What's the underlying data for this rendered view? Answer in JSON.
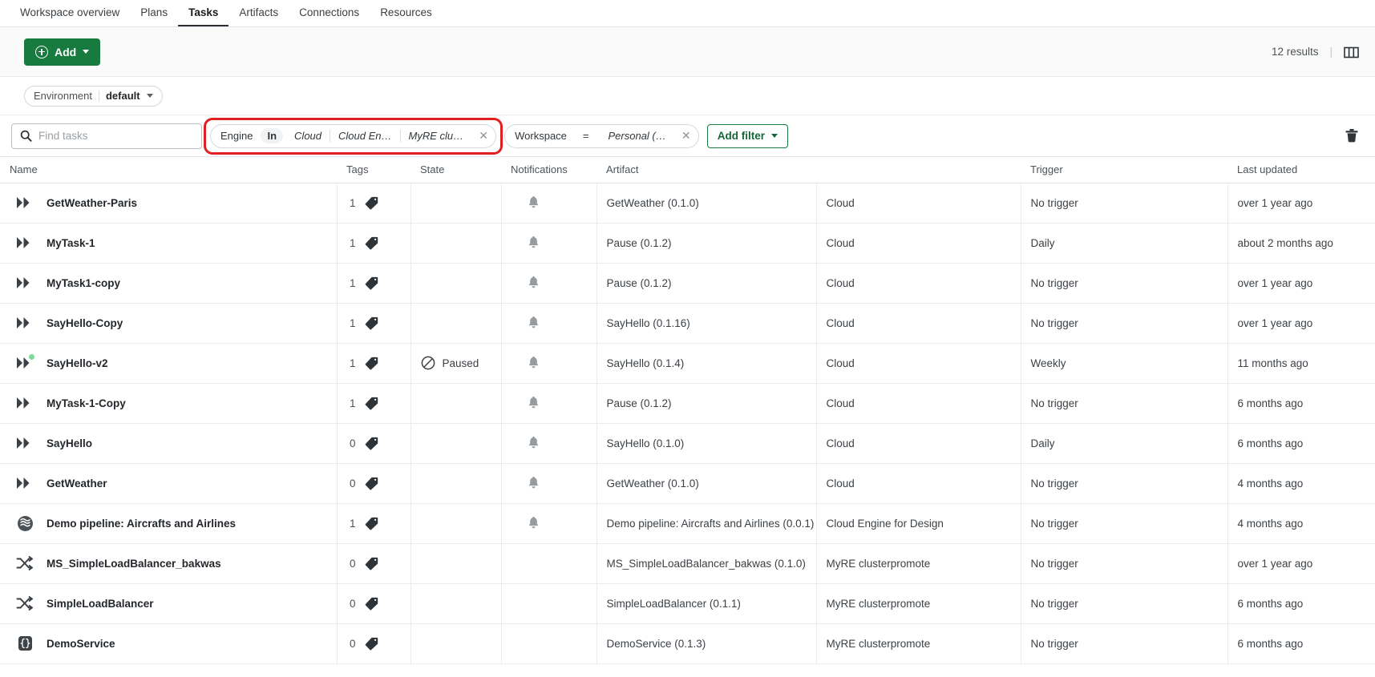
{
  "topnav": {
    "items": [
      {
        "label": "Workspace overview",
        "active": false
      },
      {
        "label": "Plans",
        "active": false
      },
      {
        "label": "Tasks",
        "active": true
      },
      {
        "label": "Artifacts",
        "active": false
      },
      {
        "label": "Connections",
        "active": false
      },
      {
        "label": "Resources",
        "active": false
      }
    ]
  },
  "actionbar": {
    "add_label": "Add",
    "results_count": "12 results",
    "separator": "|",
    "columns_icon": "columns-icon"
  },
  "environment": {
    "label": "Environment",
    "value": "default"
  },
  "search": {
    "placeholder": "Find tasks",
    "value": "",
    "icon": "search-icon"
  },
  "filters": {
    "chips": [
      {
        "field": "Engine",
        "operator": "In",
        "operator_style": "pill",
        "values": [
          "Cloud",
          "Cloud En…",
          "MyRE clu…"
        ],
        "highlighted": true
      },
      {
        "field": "Workspace",
        "operator": "=",
        "operator_style": "plain",
        "values": [
          "Personal (…"
        ],
        "highlighted": false
      }
    ],
    "add_filter_label": "Add filter",
    "clear_icon": "trash-icon",
    "highlight_color": "#e02020"
  },
  "table": {
    "columns": [
      {
        "key": "name",
        "label": "Name"
      },
      {
        "key": "tags",
        "label": "Tags"
      },
      {
        "key": "state",
        "label": "State"
      },
      {
        "key": "notifications",
        "label": "Notifications"
      },
      {
        "key": "artifact",
        "label": "Artifact"
      },
      {
        "key": "engine",
        "label": ""
      },
      {
        "key": "trigger",
        "label": "Trigger"
      },
      {
        "key": "last_updated",
        "label": "Last updated"
      }
    ],
    "rows": [
      {
        "icon": "task-chevrons-icon",
        "status_dot": false,
        "name": "GetWeather-Paris",
        "tags": "1",
        "state": "",
        "notifications": true,
        "artifact": "GetWeather (0.1.0)",
        "engine": "Cloud",
        "trigger": "No trigger",
        "last_updated": "over 1 year ago"
      },
      {
        "icon": "task-chevrons-icon",
        "status_dot": false,
        "name": "MyTask-1",
        "tags": "1",
        "state": "",
        "notifications": true,
        "artifact": "Pause (0.1.2)",
        "engine": "Cloud",
        "trigger": "Daily",
        "last_updated": "about 2 months ago"
      },
      {
        "icon": "task-chevrons-icon",
        "status_dot": false,
        "name": "MyTask1-copy",
        "tags": "1",
        "state": "",
        "notifications": true,
        "artifact": "Pause (0.1.2)",
        "engine": "Cloud",
        "trigger": "No trigger",
        "last_updated": "over 1 year ago"
      },
      {
        "icon": "task-chevrons-icon",
        "status_dot": false,
        "name": "SayHello-Copy",
        "tags": "1",
        "state": "",
        "notifications": true,
        "artifact": "SayHello (0.1.16)",
        "engine": "Cloud",
        "trigger": "No trigger",
        "last_updated": "over 1 year ago"
      },
      {
        "icon": "task-chevrons-icon",
        "status_dot": true,
        "name": "SayHello-v2",
        "tags": "1",
        "state": "Paused",
        "notifications": true,
        "artifact": "SayHello (0.1.4)",
        "engine": "Cloud",
        "trigger": "Weekly",
        "last_updated": "11 months ago"
      },
      {
        "icon": "task-chevrons-icon",
        "status_dot": false,
        "name": "MyTask-1-Copy",
        "tags": "1",
        "state": "",
        "notifications": true,
        "artifact": "Pause (0.1.2)",
        "engine": "Cloud",
        "trigger": "No trigger",
        "last_updated": "6 months ago"
      },
      {
        "icon": "task-chevrons-icon",
        "status_dot": false,
        "name": "SayHello",
        "tags": "0",
        "state": "",
        "notifications": true,
        "artifact": "SayHello (0.1.0)",
        "engine": "Cloud",
        "trigger": "Daily",
        "last_updated": "6 months ago"
      },
      {
        "icon": "task-chevrons-icon",
        "status_dot": false,
        "name": "GetWeather",
        "tags": "0",
        "state": "",
        "notifications": true,
        "artifact": "GetWeather (0.1.0)",
        "engine": "Cloud",
        "trigger": "No trigger",
        "last_updated": "4 months ago"
      },
      {
        "icon": "pipeline-icon",
        "status_dot": false,
        "name": "Demo pipeline: Aircrafts and Airlines",
        "tags": "1",
        "state": "",
        "notifications": true,
        "artifact": "Demo pipeline: Aircrafts and Airlines (0.0.1)",
        "engine": "Cloud Engine for Design",
        "trigger": "No trigger",
        "last_updated": "4 months ago"
      },
      {
        "icon": "shuffle-icon",
        "status_dot": false,
        "name": "MS_SimpleLoadBalancer_bakwas",
        "tags": "0",
        "state": "",
        "notifications": false,
        "artifact": "MS_SimpleLoadBalancer_bakwas (0.1.0)",
        "engine": "MyRE clusterpromote",
        "trigger": "No trigger",
        "last_updated": "over 1 year ago"
      },
      {
        "icon": "shuffle-icon",
        "status_dot": false,
        "name": "SimpleLoadBalancer",
        "tags": "0",
        "state": "",
        "notifications": false,
        "artifact": "SimpleLoadBalancer (0.1.1)",
        "engine": "MyRE clusterpromote",
        "trigger": "No trigger",
        "last_updated": "6 months ago"
      },
      {
        "icon": "braces-icon",
        "status_dot": false,
        "name": "DemoService",
        "tags": "0",
        "state": "",
        "notifications": false,
        "artifact": "DemoService (0.1.3)",
        "engine": "MyRE clusterpromote",
        "trigger": "No trigger",
        "last_updated": "6 months ago"
      }
    ],
    "icons": {
      "tag": "tag-icon",
      "bell": "bell-icon",
      "paused": "paused-icon"
    }
  }
}
